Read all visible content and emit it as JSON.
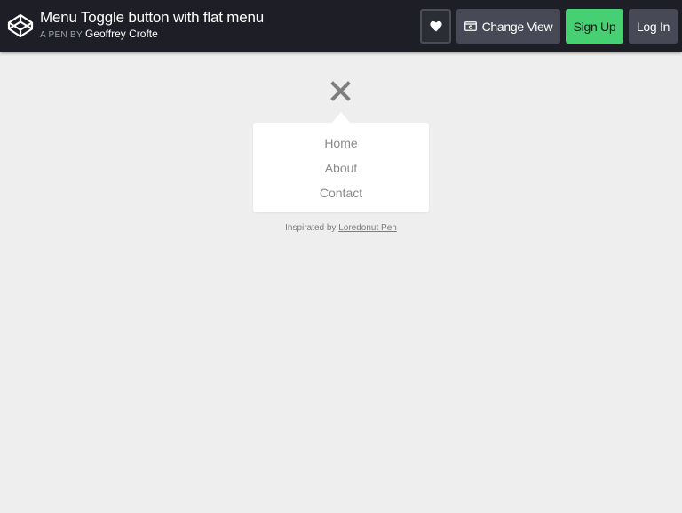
{
  "header": {
    "title": "Menu Toggle button with flat menu",
    "byline_prefix": "A PEN BY",
    "author": "Geoffrey Crofte",
    "buttons": {
      "heart_icon": "heart-icon",
      "change_view": "Change View",
      "sign_up": "Sign Up",
      "log_in": "Log In"
    },
    "colors": {
      "bar": "#1e1f26",
      "signup": "#47cf73",
      "button": "#474a56"
    }
  },
  "main": {
    "toggle_icon": "close-icon",
    "menu": {
      "items": [
        {
          "label": "Home"
        },
        {
          "label": "About"
        },
        {
          "label": "Contact"
        }
      ]
    },
    "credit": {
      "text": "Inspirated by",
      "link": "Loredonut Pen"
    },
    "colors": {
      "background": "#eeeeee",
      "menu_bg": "#ffffff",
      "menu_text": "#8a8a8a"
    }
  }
}
